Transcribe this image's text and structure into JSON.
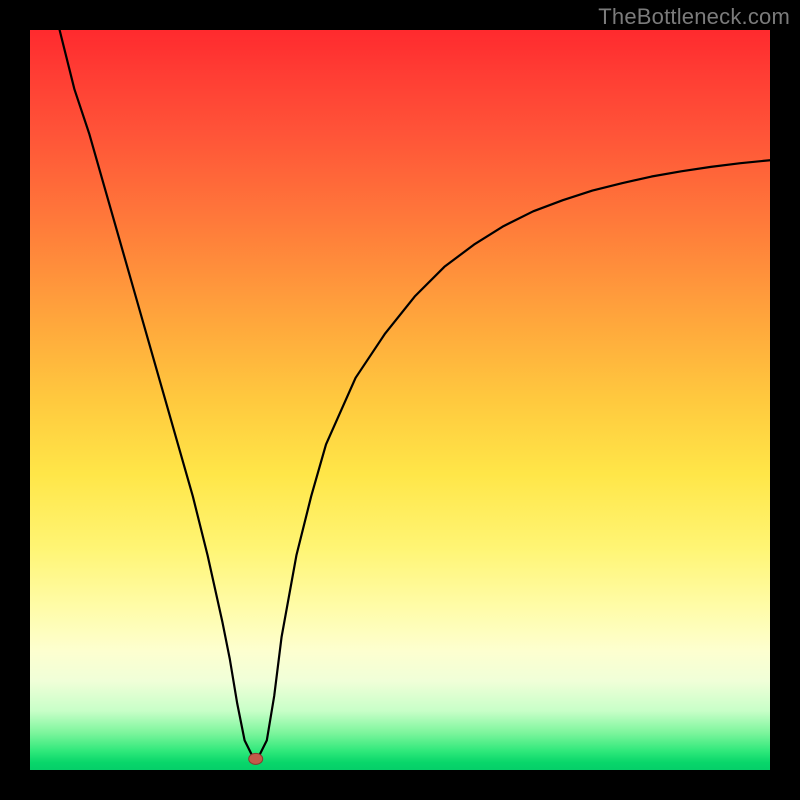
{
  "watermark": "TheBottleneck.com",
  "chart_data": {
    "type": "line",
    "title": "",
    "xlabel": "",
    "ylabel": "",
    "xlim": [
      0,
      100
    ],
    "ylim": [
      0,
      100
    ],
    "grid": false,
    "series": [
      {
        "name": "bottleneck-curve",
        "x": [
          4,
          6,
          8,
          10,
          12,
          14,
          16,
          18,
          20,
          22,
          24,
          26,
          27,
          28,
          29,
          30,
          31,
          32,
          33,
          34,
          36,
          38,
          40,
          44,
          48,
          52,
          56,
          60,
          64,
          68,
          72,
          76,
          80,
          84,
          88,
          92,
          96,
          100
        ],
        "y": [
          100,
          92,
          86,
          79,
          72,
          65,
          58,
          51,
          44,
          37,
          29,
          20,
          15,
          9,
          4,
          2,
          2,
          4,
          10,
          18,
          29,
          37,
          44,
          53,
          59,
          64,
          68,
          71,
          73.5,
          75.5,
          77,
          78.3,
          79.3,
          80.2,
          80.9,
          81.5,
          82,
          82.4
        ]
      }
    ],
    "minimum_marker": {
      "x": 30.5,
      "y": 1.5
    },
    "background_gradient": {
      "top": "#ff2a2e",
      "mid": "#ffe648",
      "bottom": "#06cf69"
    }
  }
}
